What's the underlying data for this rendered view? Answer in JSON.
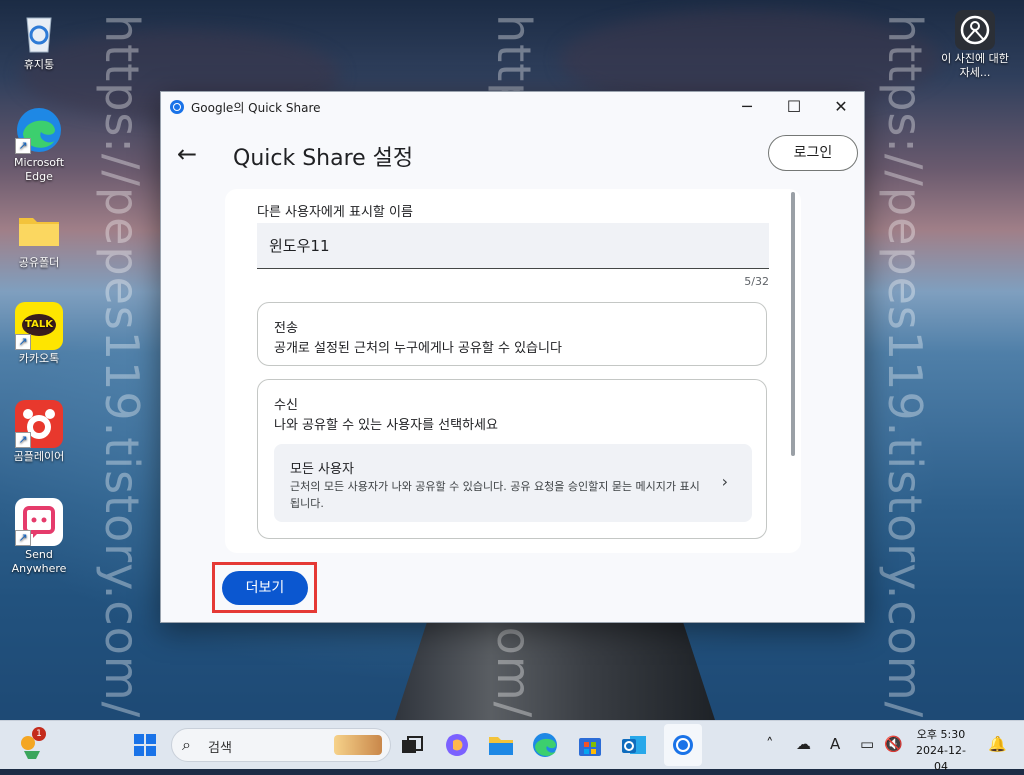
{
  "desktop": {
    "icons": [
      {
        "label": "휴지통",
        "icon": "recycle-bin-icon"
      },
      {
        "label": "Microsoft Edge",
        "icon": "edge-icon"
      },
      {
        "label": "공유폴더",
        "icon": "folder-icon"
      },
      {
        "label": "카카오톡",
        "icon": "kakaotalk-icon",
        "badge_text": "TALK"
      },
      {
        "label": "곰플레이어",
        "icon": "gom-player-icon"
      },
      {
        "label": "Send Anywhere",
        "icon": "send-anywhere-icon"
      },
      {
        "label": "이 사진에 대한 자세...",
        "icon": "photo-info-icon"
      }
    ],
    "watermark": "https://pepes119.tistory.com/"
  },
  "window": {
    "title": "Google의 Quick Share",
    "controls": {
      "minimize": "─",
      "maximize": "☐",
      "close": "✕"
    },
    "page_title": "Quick Share 설정",
    "back_icon": "←",
    "login_label": "로그인",
    "name_label": "다른 사용자에게 표시할 이름",
    "name_value": "윈도우11",
    "name_counter": "5/32",
    "send": {
      "title": "전송",
      "description": "공개로 설정된 근처의 누구에게나 공유할 수 있습니다"
    },
    "receive": {
      "title": "수신",
      "description": "나와 공유할 수 있는 사용자를 선택하세요",
      "option_title": "모든 사용자",
      "option_description": "근처의 모든 사용자가 나와 공유할 수 있습니다. 공유 요청을 승인할지 묻는 메시지가 표시됩니다.",
      "chevron": "›"
    },
    "more_label": "더보기"
  },
  "taskbar": {
    "widgets_badge": "1",
    "search_placeholder": "검색",
    "clock_time": "오후 5:30",
    "clock_date": "2024-12-04",
    "ime_label": "A"
  }
}
